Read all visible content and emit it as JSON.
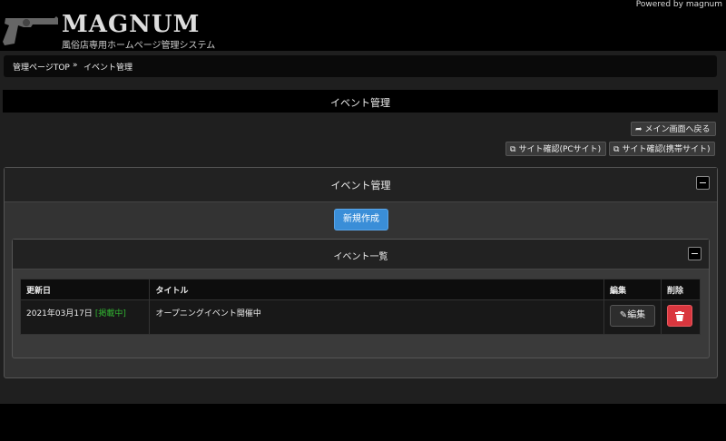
{
  "header": {
    "logo_title": "MAGNUM",
    "logo_subtitle": "風俗店専用ホームページ管理システム",
    "powered_by": "Powered by magnum"
  },
  "breadcrumb": {
    "home": "管理ページTOP",
    "separator": "»",
    "current": "イベント管理"
  },
  "page": {
    "title": "イベント管理"
  },
  "actions": {
    "back_to_main": "メイン画面へ戻る",
    "site_check_pc": "サイト確認(PCサイト)",
    "site_check_mobile": "サイト確認(携帯サイト)"
  },
  "panel": {
    "title": "イベント管理",
    "collapse_symbol": "−",
    "new_button": "新規作成",
    "list": {
      "title": "イベント一覧",
      "collapse_symbol": "−",
      "columns": {
        "updated": "更新日",
        "title": "タイトル",
        "edit": "編集",
        "delete": "削除"
      },
      "rows": [
        {
          "date": "2021年03月17日",
          "status": "[掲載中]",
          "title": "オープニングイベント開催中",
          "edit_label": "編集"
        }
      ]
    }
  },
  "colors": {
    "primary_button": "#3a8ed8",
    "danger_button": "#d9363e",
    "status_active": "#32b432"
  }
}
